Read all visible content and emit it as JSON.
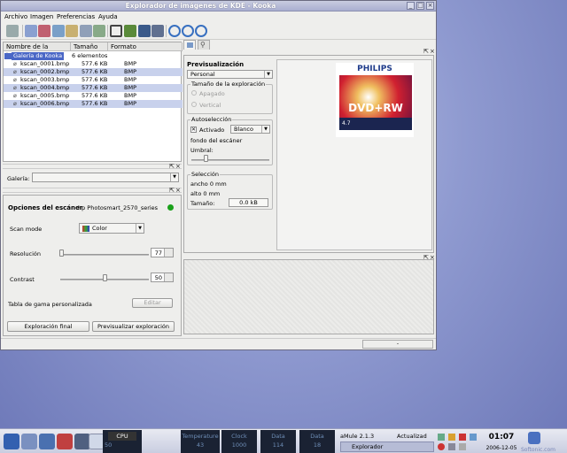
{
  "window": {
    "title": "Explorador de imágenes de KDE - Kooka",
    "menus": [
      "Archivo",
      "Imagen",
      "Preferencias",
      "Ayuda"
    ],
    "toolbar_icons": [
      "print-icon",
      "copy-icon",
      "copy-icon",
      "image-icon",
      "mail-icon",
      "save-icon",
      "crop-icon",
      "mirror-icon",
      "flip-icon",
      "rotate-cw-icon",
      "rotate-ccw-icon",
      "undo-icon"
    ]
  },
  "gallery": {
    "columns": [
      "Nombre de la imagen",
      "Tamaño",
      "Formato"
    ],
    "root": {
      "name": "Galería de Kooka",
      "count": "6 elementos"
    },
    "files": [
      {
        "name": "kscan_0001.bmp",
        "size": "577.6 KB",
        "format": "BMP"
      },
      {
        "name": "kscan_0002.bmp",
        "size": "577.6 KB",
        "format": "BMP"
      },
      {
        "name": "kscan_0003.bmp",
        "size": "577.6 KB",
        "format": "BMP"
      },
      {
        "name": "kscan_0004.bmp",
        "size": "577.6 KB",
        "format": "BMP"
      },
      {
        "name": "kscan_0005.bmp",
        "size": "577.6 KB",
        "format": "BMP"
      },
      {
        "name": "kscan_0006.bmp",
        "size": "577.6 KB",
        "format": "BMP"
      }
    ],
    "gallery_label": "Galería:"
  },
  "scanner": {
    "title": "Opciones del escáner",
    "device": "hp Photosmart_2570_series",
    "scan_mode_label": "Scan mode",
    "scan_mode_value": "Color",
    "resolution_label": "Resolución",
    "resolution_value": "77",
    "contrast_label": "Contrast",
    "contrast_value": "50",
    "gamma_label": "Tabla de gama personalizada",
    "gamma_button": "Editar",
    "final_button": "Exploración final",
    "preview_button": "Previsualizar exploración"
  },
  "preview": {
    "title": "Previsualización",
    "preset": "Personal",
    "orientation_group": "Tamaño de la exploración",
    "orientation_off": "Apagado",
    "orientation_vertical": "Vertical",
    "auto_group": "Autoselección",
    "auto_checkbox": "Activado",
    "auto_color": "Blanco",
    "auto_text": "fondo del escáner",
    "threshold_label": "Umbral:",
    "selection_group": "Selección",
    "sel_width": "ancho 0 mm",
    "sel_height": "alto 0 mm",
    "size_label": "Tamaño:",
    "size_value": "0.0 kB",
    "image_brand": "PHILIPS",
    "image_product": "DVD+RW",
    "image_cap": "4.7"
  },
  "taskbar": {
    "cpu_label": "CPU",
    "cpu_value": "50",
    "monitors": [
      {
        "label": "Temperature",
        "value": "43"
      },
      {
        "label": "Clock",
        "value": "1000"
      },
      {
        "label": "Data",
        "value": "114"
      },
      {
        "label": "Data",
        "value": "18"
      }
    ],
    "tasks": [
      "aMule 2.1.3",
      "Actualizad",
      "Explorador"
    ],
    "clock": "01:07",
    "date": "2006-12-05",
    "watermark": "Softonic.com"
  },
  "status_dot_color": "#1aa11a"
}
